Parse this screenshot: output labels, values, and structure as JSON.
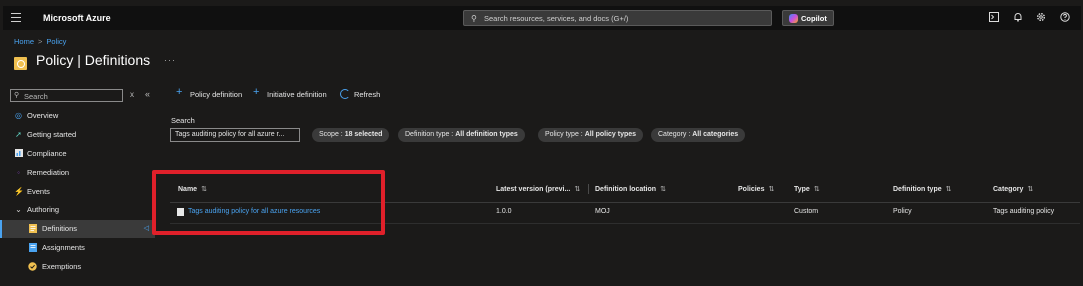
{
  "topbar": {
    "brand": "Microsoft Azure",
    "search_placeholder": "Search resources, services, and docs (G+/)",
    "copilot_label": "Copilot",
    "icons": [
      "terminal-icon",
      "bell-icon",
      "gear-icon",
      "help-icon"
    ]
  },
  "breadcrumb": {
    "home": "Home",
    "separator": ">",
    "current": "Policy"
  },
  "page": {
    "title": "Policy | Definitions",
    "more": "···"
  },
  "sidebar": {
    "search_placeholder": "Search",
    "clear": "x",
    "collapse": "«",
    "items": [
      {
        "label": "Overview",
        "icon": "overview-icon"
      },
      {
        "label": "Getting started",
        "icon": "rocket-icon"
      },
      {
        "label": "Compliance",
        "icon": "compliance-icon"
      },
      {
        "label": "Remediation",
        "icon": "remediation-icon"
      },
      {
        "label": "Events",
        "icon": "lightning-icon"
      },
      {
        "label": "Authoring",
        "icon": "chevron-down-icon"
      },
      {
        "label": "Definitions",
        "icon": "document-icon",
        "active": true
      },
      {
        "label": "Assignments",
        "icon": "assignment-icon"
      },
      {
        "label": "Exemptions",
        "icon": "exemption-icon"
      }
    ]
  },
  "toolbar": {
    "policy_definition": "Policy definition",
    "initiative_definition": "Initiative definition",
    "refresh": "Refresh"
  },
  "filters": {
    "search_label": "Search",
    "search_value": "Tags auditing policy for all azure r...",
    "scope_key": "Scope : ",
    "scope_val": "18 selected",
    "def_type_key": "Definition type : ",
    "def_type_val": "All definition types",
    "policy_type_key": "Policy type : ",
    "policy_type_val": "All policy types",
    "category_key": "Category : ",
    "category_val": "All categories"
  },
  "table": {
    "columns": [
      "Name",
      "Latest version (previ...",
      "Definition location",
      "Policies",
      "Type",
      "Definition type",
      "Category"
    ],
    "sort_glyph": "⇅",
    "rows": [
      {
        "name": "Tags auditing policy for all azure resources",
        "version": "1.0.0",
        "location": "MOJ",
        "policies": "",
        "type": "Custom",
        "definition_type": "Policy",
        "category": "Tags auditing policy"
      }
    ]
  },
  "colors": {
    "accent": "#4aa3f0",
    "highlight": "#e0202a",
    "background": "#1b1a19"
  }
}
